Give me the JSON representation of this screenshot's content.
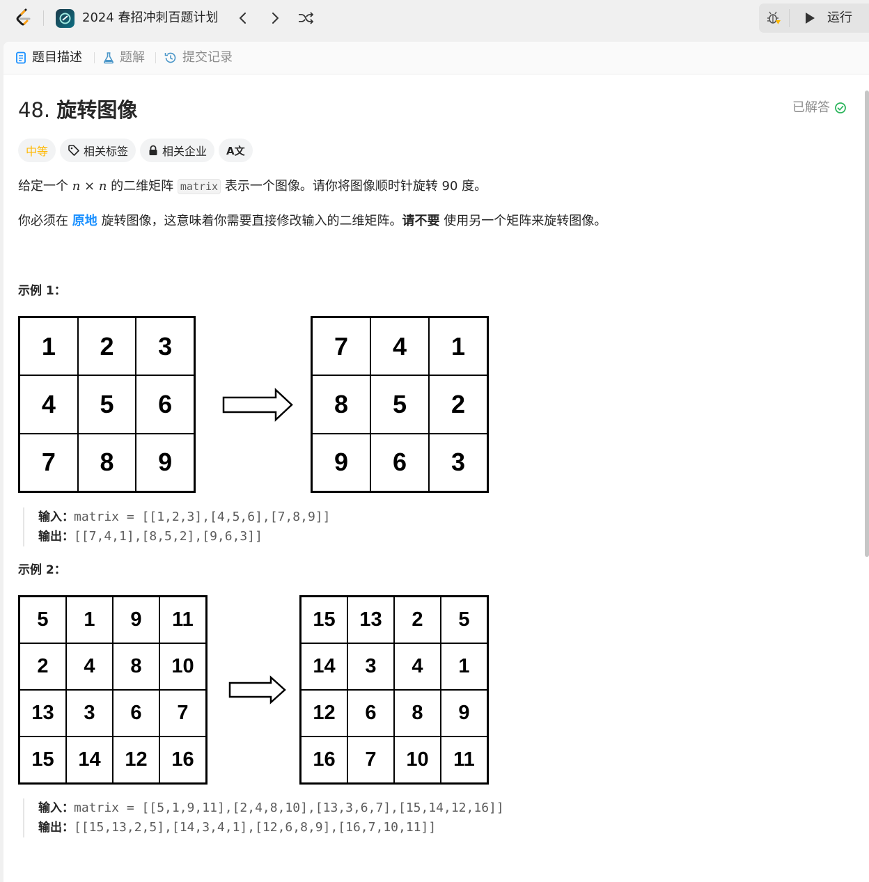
{
  "header": {
    "plan_title": "2024 春招冲刺百题计划",
    "run_label": "运行",
    "logo_icon": "leetcode-logo-icon",
    "prev_icon": "chevron-left-icon",
    "next_icon": "chevron-right-icon",
    "shuffle_icon": "shuffle-icon",
    "debug_icon": "debug-bug-icon",
    "run_icon": "play-icon"
  },
  "tabs": [
    {
      "label": "题目描述",
      "icon": "description-icon",
      "active": true
    },
    {
      "label": "题解",
      "icon": "flask-icon",
      "active": false
    },
    {
      "label": "提交记录",
      "icon": "history-icon",
      "active": false
    }
  ],
  "problem": {
    "number": "48.",
    "name": "旋转图像",
    "status": "已解答",
    "status_color": "#2db55d",
    "tags": {
      "difficulty": "中等",
      "difficulty_color": "#ffb800",
      "topics": "相关标签",
      "companies": "相关企业",
      "translate": "A文"
    },
    "desc1": {
      "a": "给定一个 ",
      "n1": "n",
      "times": " × ",
      "n2": "n",
      "b": " 的二维矩阵 ",
      "code": "matrix",
      "c": " 表示一个图像。请你将图像顺时针旋转 90 度。"
    },
    "desc2": {
      "a": "你必须在 ",
      "hl": "原地",
      "b": " 旋转图像，这意味着你需要直接修改输入的二维矩阵。",
      "bold": "请不要",
      "c": " 使用另一个矩阵来旋转图像。"
    },
    "accent_color": "#1a90ff"
  },
  "examples": [
    {
      "title": "示例 1：",
      "input_matrix": [
        [
          "1",
          "2",
          "3"
        ],
        [
          "4",
          "5",
          "6"
        ],
        [
          "7",
          "8",
          "9"
        ]
      ],
      "output_matrix": [
        [
          "7",
          "4",
          "1"
        ],
        [
          "8",
          "5",
          "2"
        ],
        [
          "9",
          "6",
          "3"
        ]
      ],
      "input_label": "输入：",
      "input_text": "matrix = [[1,2,3],[4,5,6],[7,8,9]]",
      "output_label": "输出：",
      "output_text": "[[7,4,1],[8,5,2],[9,6,3]]"
    },
    {
      "title": "示例 2：",
      "input_matrix": [
        [
          "5",
          "1",
          "9",
          "11"
        ],
        [
          "2",
          "4",
          "8",
          "10"
        ],
        [
          "13",
          "3",
          "6",
          "7"
        ],
        [
          "15",
          "14",
          "12",
          "16"
        ]
      ],
      "output_matrix": [
        [
          "15",
          "13",
          "2",
          "5"
        ],
        [
          "14",
          "3",
          "4",
          "1"
        ],
        [
          "12",
          "6",
          "8",
          "9"
        ],
        [
          "16",
          "7",
          "10",
          "11"
        ]
      ],
      "input_label": "输入：",
      "input_text": "matrix = [[5,1,9,11],[2,4,8,10],[13,3,6,7],[15,14,12,16]]",
      "output_label": "输出：",
      "output_text": "[[15,13,2,5],[14,3,4,1],[12,6,8,9],[16,7,10,11]]"
    }
  ]
}
